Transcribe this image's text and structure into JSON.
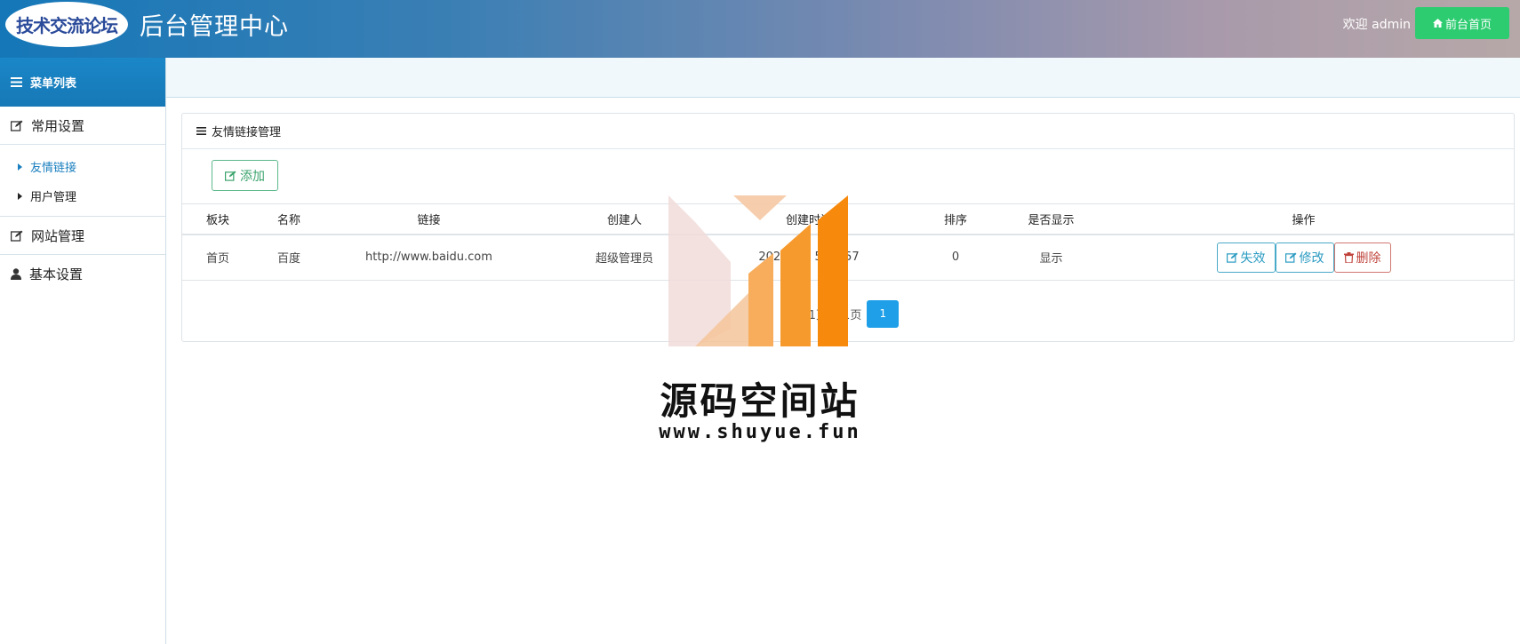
{
  "header": {
    "logo_text": "技术交流论坛",
    "title": "后台管理中心",
    "welcome": "欢迎 admin",
    "home_button": "前台首页"
  },
  "sidebar": {
    "heading": "菜单列表",
    "groups": [
      {
        "label": "常用设置",
        "icon": "edit-icon",
        "items": [
          {
            "label": "友情链接",
            "active": true
          },
          {
            "label": "用户管理",
            "active": false
          }
        ]
      },
      {
        "label": "网站管理",
        "icon": "edit-icon"
      },
      {
        "label": "基本设置",
        "icon": "user-icon"
      }
    ]
  },
  "panel": {
    "title": "友情链接管理",
    "add_button": "添加",
    "table": {
      "headers": [
        "板块",
        "名称",
        "链接",
        "创建人",
        "创建时间",
        "排序",
        "是否显示",
        "操作"
      ],
      "rows": [
        {
          "section": "首页",
          "name": "百度",
          "url": "http://www.baidu.com",
          "creator": "超级管理员",
          "created_at": "2020-09-  5:23:57",
          "order": "0",
          "visible": "显示"
        }
      ]
    },
    "actions": {
      "expire": "失效",
      "edit": "修改",
      "delete": "删除"
    },
    "pager": {
      "text": "第1页 共1页",
      "current": "1"
    }
  },
  "watermark": {
    "title": "源码空间站",
    "url": "www.shuyue.fun"
  },
  "colors": {
    "header_start": "#1577b8",
    "header_end": "#b6a8a8",
    "home_button": "#2ecc71",
    "accent_blue": "#1a87c8",
    "pager_active": "#1e9fe8",
    "add_green": "#3aa36c",
    "delete_red": "#c0443c",
    "watermark_orange": "#f7890c"
  }
}
